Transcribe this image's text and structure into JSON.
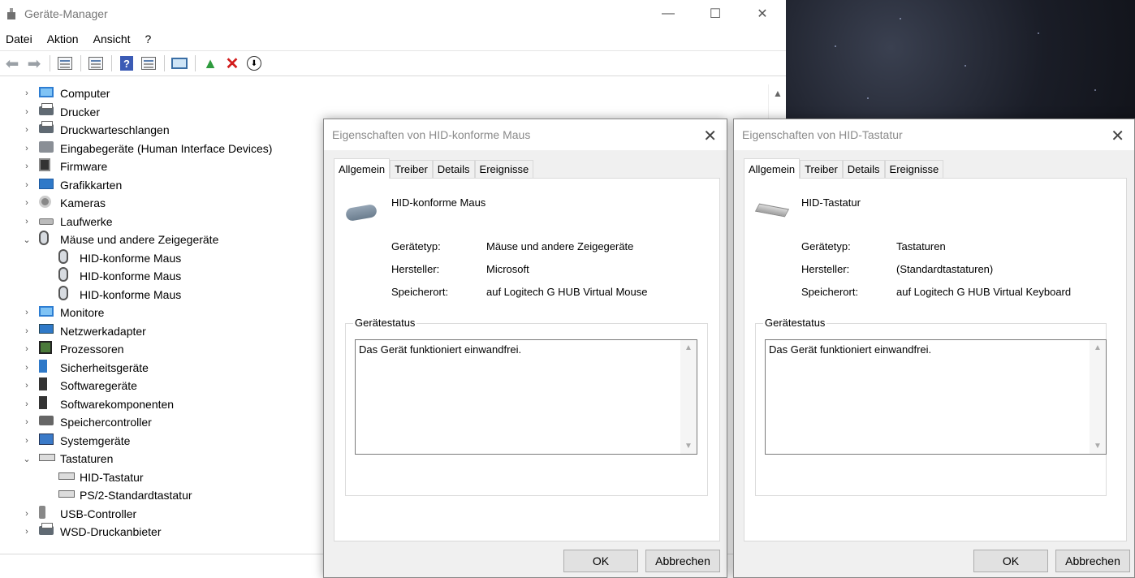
{
  "window": {
    "title": "Geräte-Manager",
    "minimize": "—",
    "maximize": "☐",
    "close": "✕"
  },
  "menu": [
    "Datei",
    "Aktion",
    "Ansicht",
    "?"
  ],
  "toolbar": {
    "back": "⬅",
    "forward": "➡",
    "help": "?",
    "remove": "✕",
    "update": "⬇"
  },
  "tree": {
    "items": [
      {
        "label": "Computer",
        "icon": "monitor-icon",
        "expanded": false
      },
      {
        "label": "Drucker",
        "icon": "printer-icon",
        "expanded": false
      },
      {
        "label": "Druckwarteschlangen",
        "icon": "printer-icon",
        "expanded": false
      },
      {
        "label": "Eingabegeräte (Human Interface Devices)",
        "icon": "hid-icon",
        "expanded": false
      },
      {
        "label": "Firmware",
        "icon": "chip-icon",
        "expanded": false
      },
      {
        "label": "Grafikkarten",
        "icon": "display-adapter-icon",
        "expanded": false
      },
      {
        "label": "Kameras",
        "icon": "camera-icon",
        "expanded": false
      },
      {
        "label": "Laufwerke",
        "icon": "drive-icon",
        "expanded": false
      },
      {
        "label": "Mäuse und andere Zeigegeräte",
        "icon": "mouse-icon",
        "expanded": true
      },
      {
        "label": "HID-konforme Maus",
        "icon": "mouse-icon",
        "child": true
      },
      {
        "label": "HID-konforme Maus",
        "icon": "mouse-icon",
        "child": true
      },
      {
        "label": "HID-konforme Maus",
        "icon": "mouse-icon",
        "child": true
      },
      {
        "label": "Monitore",
        "icon": "monitor-icon",
        "expanded": false
      },
      {
        "label": "Netzwerkadapter",
        "icon": "network-icon",
        "expanded": false
      },
      {
        "label": "Prozessoren",
        "icon": "cpu-icon",
        "expanded": false
      },
      {
        "label": "Sicherheitsgeräte",
        "icon": "key-icon",
        "expanded": false
      },
      {
        "label": "Softwaregeräte",
        "icon": "software-icon",
        "expanded": false
      },
      {
        "label": "Softwarekomponenten",
        "icon": "software-icon",
        "expanded": false
      },
      {
        "label": "Speichercontroller",
        "icon": "storage-icon",
        "expanded": false
      },
      {
        "label": "Systemgeräte",
        "icon": "system-icon",
        "expanded": false
      },
      {
        "label": "Tastaturen",
        "icon": "keyboard-icon",
        "expanded": true
      },
      {
        "label": "HID-Tastatur",
        "icon": "keyboard-icon",
        "child": true
      },
      {
        "label": "PS/2-Standardtastatur",
        "icon": "keyboard-icon",
        "child": true
      },
      {
        "label": "USB-Controller",
        "icon": "usb-icon",
        "expanded": false
      },
      {
        "label": "WSD-Druckanbieter",
        "icon": "printer-icon",
        "expanded": false
      }
    ]
  },
  "dialog_mouse": {
    "title": "Eigenschaften von HID-konforme Maus",
    "tabs": [
      "Allgemein",
      "Treiber",
      "Details",
      "Ereignisse"
    ],
    "device_name": "HID-konforme Maus",
    "props": [
      {
        "label": "Gerätetyp:",
        "value": "Mäuse und andere Zeigegeräte"
      },
      {
        "label": "Hersteller:",
        "value": "Microsoft"
      },
      {
        "label": "Speicherort:",
        "value": "auf Logitech G HUB Virtual Mouse"
      }
    ],
    "status_label": "Gerätestatus",
    "status_text": "Das Gerät funktioniert einwandfrei.",
    "ok": "OK",
    "cancel": "Abbrechen"
  },
  "dialog_keyboard": {
    "title": "Eigenschaften von HID-Tastatur",
    "tabs": [
      "Allgemein",
      "Treiber",
      "Details",
      "Ereignisse"
    ],
    "device_name": "HID-Tastatur",
    "props": [
      {
        "label": "Gerätetyp:",
        "value": "Tastaturen"
      },
      {
        "label": "Hersteller:",
        "value": "(Standardtastaturen)"
      },
      {
        "label": "Speicherort:",
        "value": "auf Logitech G HUB Virtual Keyboard"
      }
    ],
    "status_label": "Gerätestatus",
    "status_text": "Das Gerät funktioniert einwandfrei.",
    "ok": "OK",
    "cancel": "Abbrechen"
  }
}
